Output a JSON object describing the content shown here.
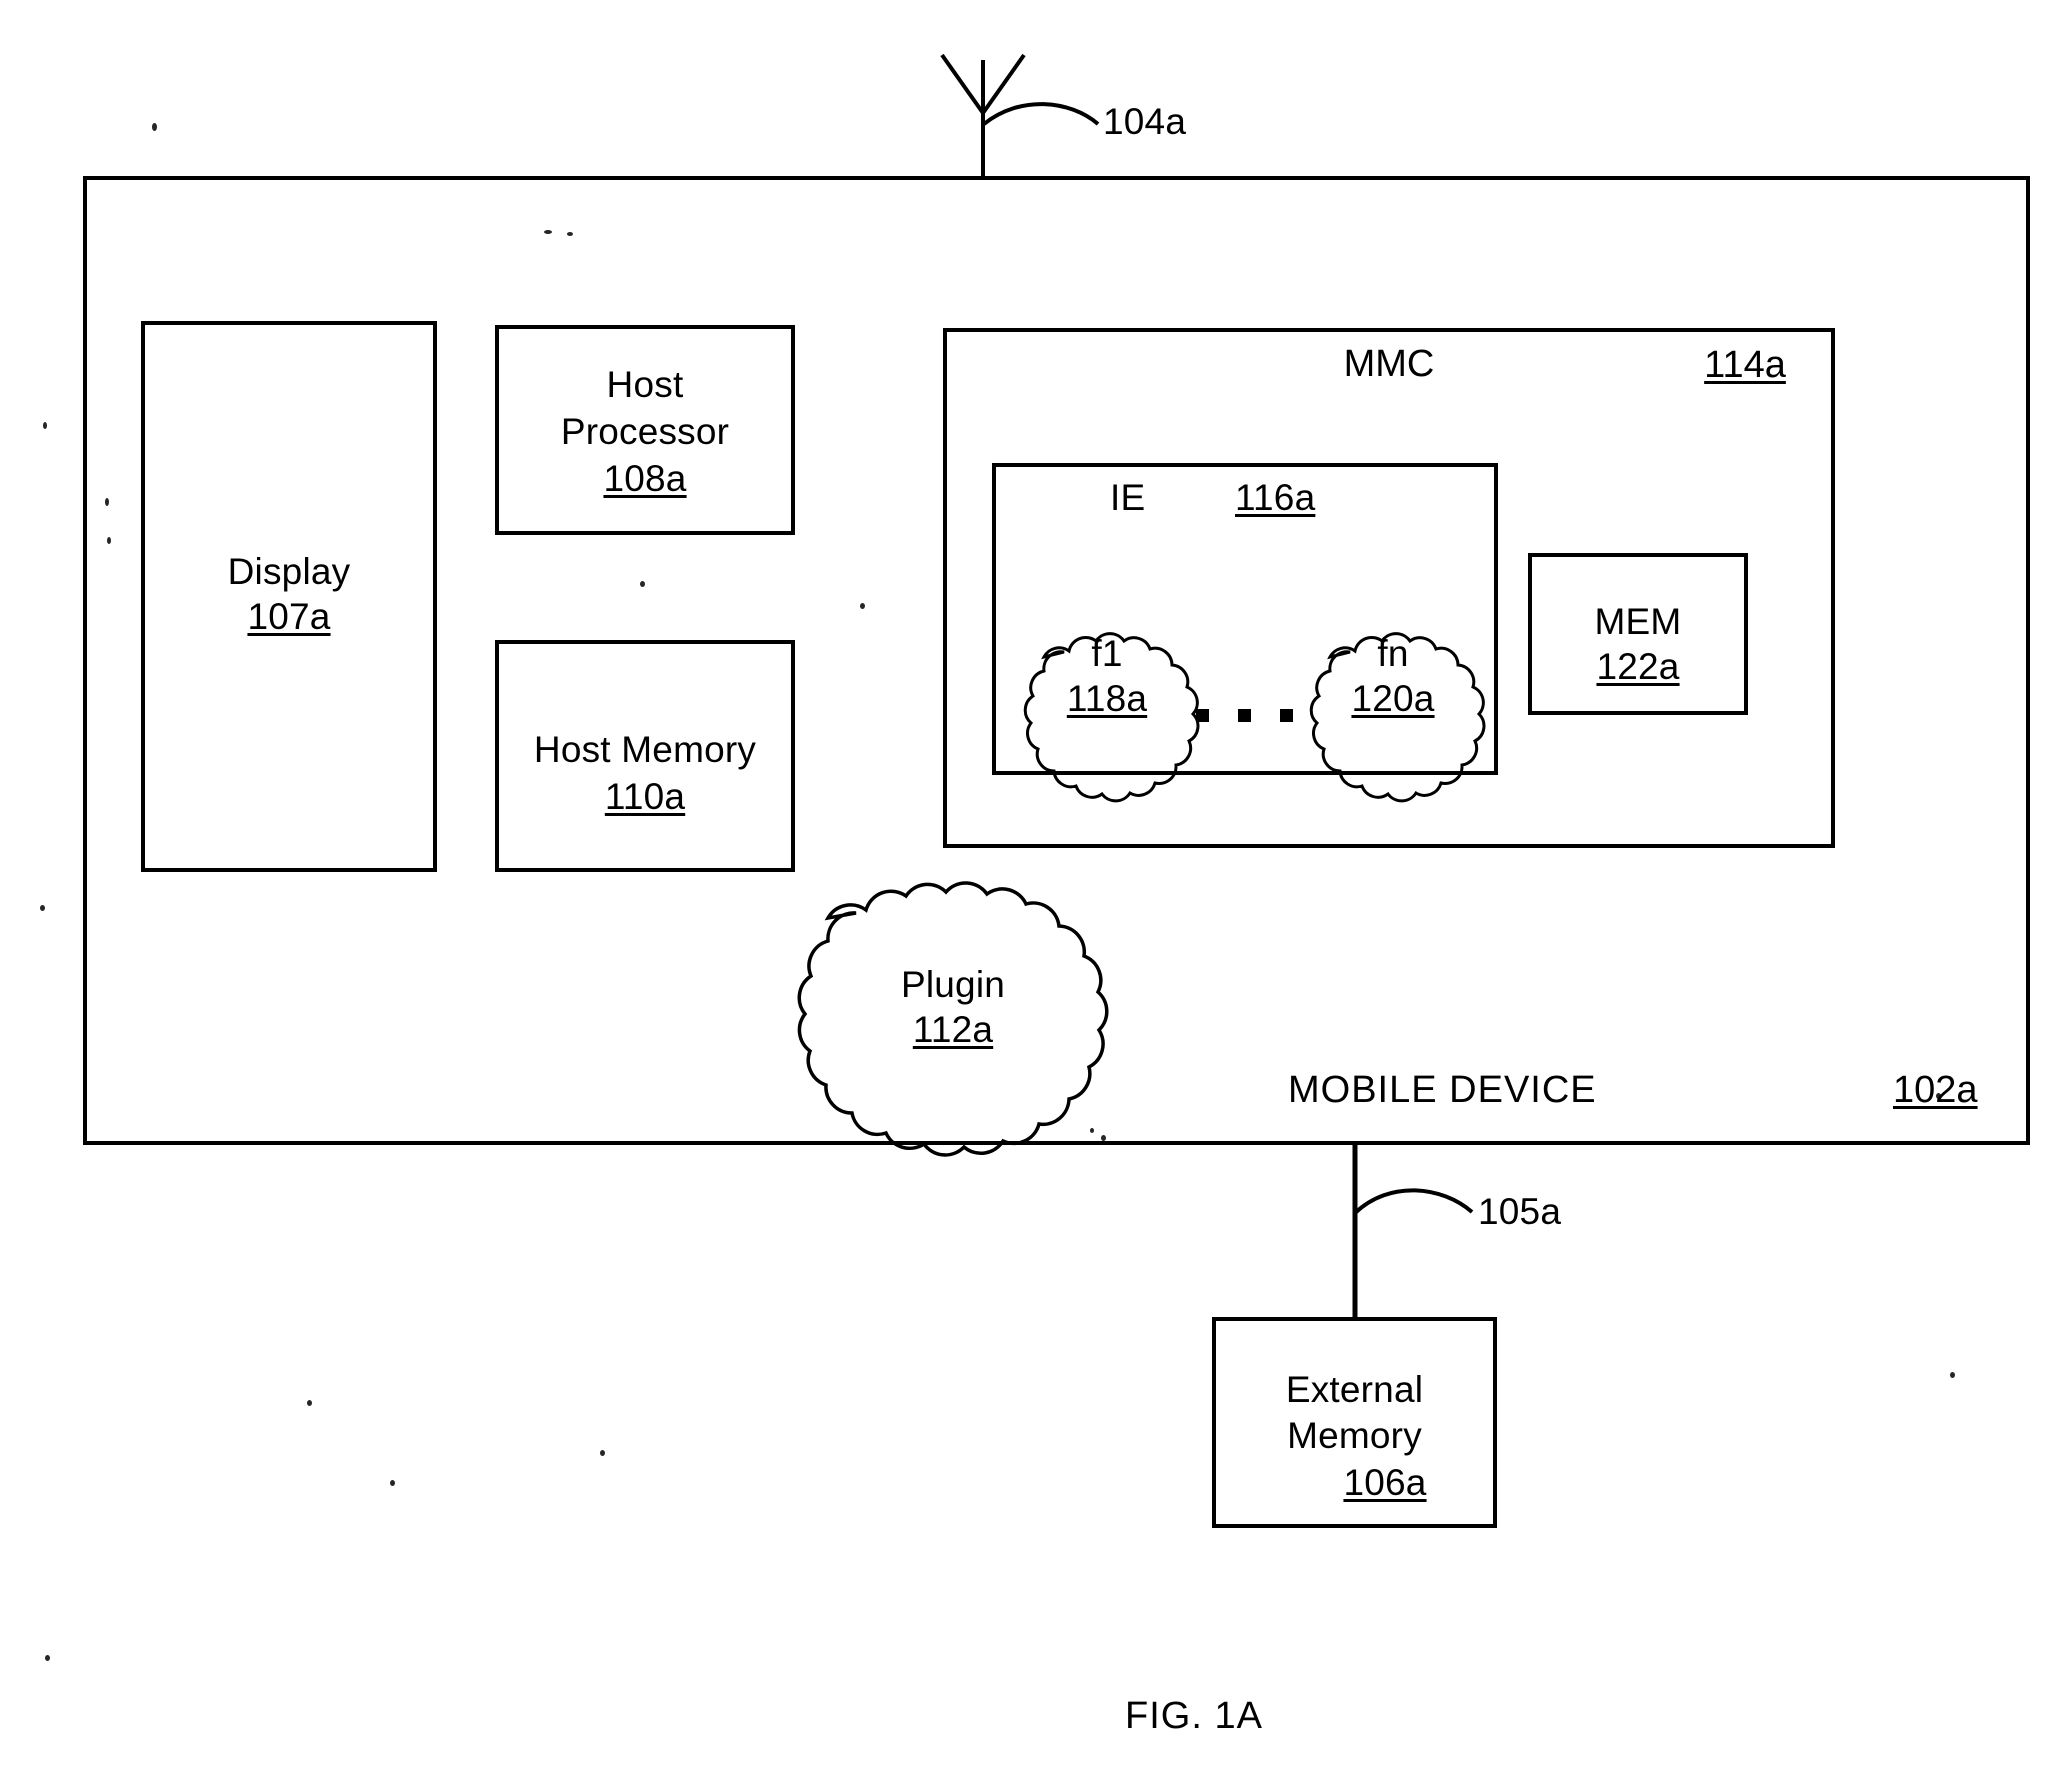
{
  "figure": {
    "caption": "FIG. 1A"
  },
  "antenna": {
    "ref": "104a"
  },
  "mobile_device": {
    "title": "MOBILE DEVICE",
    "ref": "102a"
  },
  "display": {
    "label": "Display",
    "ref": "107a"
  },
  "host_processor": {
    "line1": "Host",
    "line2": "Processor",
    "ref": "108a"
  },
  "host_memory": {
    "label": "Host Memory",
    "ref": "110a"
  },
  "plugin": {
    "label": "Plugin",
    "ref": "112a"
  },
  "mmc": {
    "label": "MMC",
    "ref": "114a"
  },
  "ie": {
    "label": "IE",
    "ref": "116a"
  },
  "function_first": {
    "label": "f1",
    "ref": "118a"
  },
  "function_last": {
    "label": "fn",
    "ref": "120a"
  },
  "ellipsis": {
    "symbol": "▪ ▪ ▪"
  },
  "mem": {
    "label": "MEM",
    "ref": "122a"
  },
  "external_memory": {
    "line1": "External",
    "line2": "Memory",
    "ref": "106a"
  },
  "external_link": {
    "ref": "105a"
  },
  "colors": {
    "ink": "#000000",
    "paper": "#ffffff"
  }
}
